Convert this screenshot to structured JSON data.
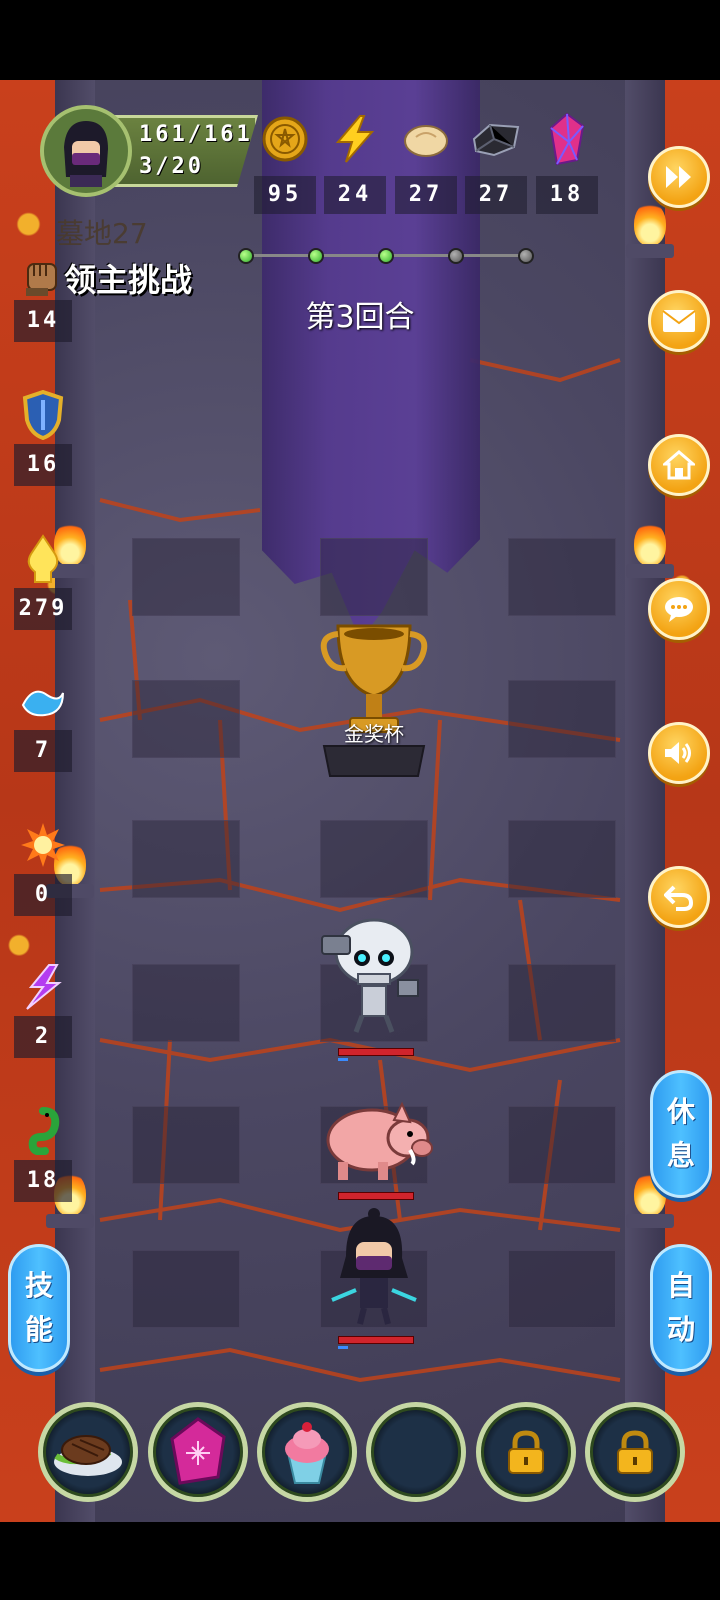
{
  "player": {
    "hp": "161/161",
    "level": "3/20"
  },
  "resources": [
    {
      "icon": "gold-coin-icon",
      "value": "95"
    },
    {
      "icon": "lightning-icon",
      "value": "24"
    },
    {
      "icon": "bread-icon",
      "value": "27"
    },
    {
      "icon": "iron-ore-icon",
      "value": "27"
    },
    {
      "icon": "crystal-icon",
      "value": "18"
    }
  ],
  "location": "墓地27",
  "challenge_label": "领主挑战",
  "round_label": "第3回合",
  "trophy_label": "金奖杯",
  "round_progress": {
    "total": 5,
    "completed": 3
  },
  "skills": [
    {
      "icon": "fist-icon",
      "value": "14"
    },
    {
      "icon": "shield-icon",
      "value": "16"
    },
    {
      "icon": "golden-ghost-icon",
      "value": "279"
    },
    {
      "icon": "water-wave-icon",
      "value": "7"
    },
    {
      "icon": "fire-burst-icon",
      "value": "0"
    },
    {
      "icon": "purple-lightning-icon",
      "value": "2"
    },
    {
      "icon": "green-serpent-icon",
      "value": "18"
    }
  ],
  "side_buttons": {
    "rest": "休息",
    "auto": "自动",
    "skill": "技能"
  },
  "units": [
    {
      "name": "skeleton-enemy",
      "hp_fraction": 1.0
    },
    {
      "name": "boar-enemy",
      "hp_fraction": 1.0
    },
    {
      "name": "ninja-hero",
      "hp_fraction": 1.0
    }
  ],
  "colors": {
    "accent_orange": "#f3a313",
    "accent_blue": "#3aaef5",
    "lava": "#c9401c"
  }
}
